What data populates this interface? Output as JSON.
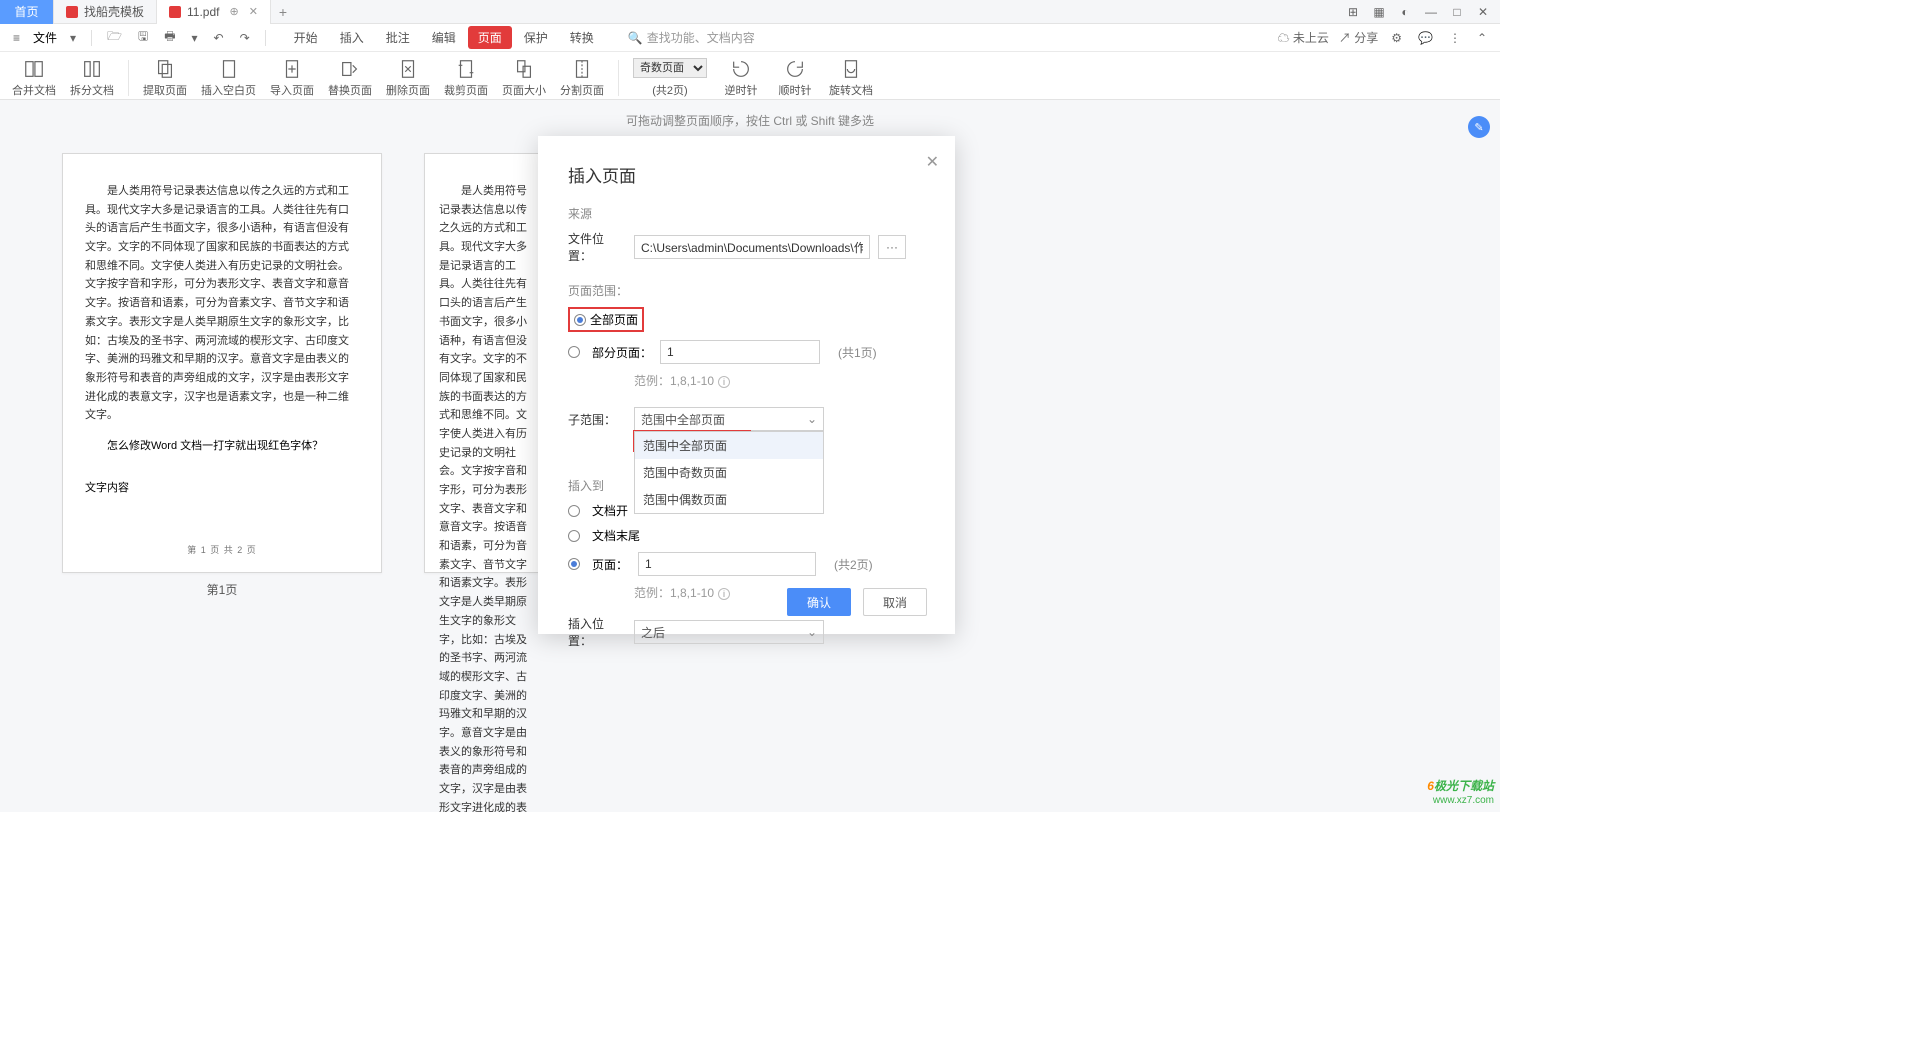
{
  "tabs": {
    "home": "首页",
    "t1": "找船壳模板",
    "t2": "11.pdf"
  },
  "window_icons": {
    "layout": "⊞",
    "grid": "▦",
    "user": "◐",
    "min": "—",
    "max": "□",
    "close": "✕"
  },
  "menu": {
    "file": "文件",
    "tabs": [
      "开始",
      "插入",
      "批注",
      "编辑",
      "页面",
      "保护",
      "转换"
    ],
    "active": "页面",
    "search_ph": "查找功能、文档内容"
  },
  "menu_right": {
    "cloud": "未上云",
    "share": "分享"
  },
  "ribbon": {
    "merge": "合并文档",
    "split": "拆分文档",
    "extract": "提取页面",
    "blank": "插入空白页",
    "import": "导入页面",
    "replace": "替换页面",
    "delete": "删除页面",
    "crop": "裁剪页面",
    "size": "页面大小",
    "splitpg": "分割页面",
    "pages_sel": "奇数页面",
    "pages_total": "(共2页)",
    "ccw": "逆时针",
    "cw": "顺时针",
    "rotate": "旋转文档"
  },
  "hint": "可拖动调整页面顺序，按住 Ctrl 或 Shift 键多选",
  "page": {
    "body": "是人类用符号记录表达信息以传之久远的方式和工具。现代文字大多是记录语言的工具。人类往往先有口头的语言后产生书面文字，很多小语种，有语言但没有文字。文字的不同体现了国家和民族的书面表达的方式和思维不同。文字使人类进入有历史记录的文明社会。文字按字音和字形，可分为表形文字、表音文字和意音文字。按语音和语素，可分为音素文字、音节文字和语素文字。表形文字是人类早期原生文字的象形文字，比如：古埃及的圣书字、两河流域的楔形文字、古印度文字、美洲的玛雅文和早期的汉字。意音文字是由表义的象形符号和表音的声旁组成的文字，汉字是由表形文字进化成的表意文字，汉字也是语素文字，也是一种二维文字。",
    "q": "怎么修改Word 文档一打字就出现红色字体？",
    "h": "文字内容",
    "footer": "第 1 页 共 2 页",
    "label": "第1页"
  },
  "dialog": {
    "title": "插入页面",
    "close": "✕",
    "src_label": "来源",
    "file_label": "文件位置：",
    "file_path": "C:\\Users\\admin\\Documents\\Downloads\\作文.docx",
    "browse": "···",
    "range_label": "页面范围：",
    "all": "全部页面",
    "partial": "部分页面：",
    "partial_val": "1",
    "partial_total": "(共1页)",
    "example": "范例：1,8,1-10",
    "sub_label": "子范围：",
    "sub_sel": "范围中全部页面",
    "opts": [
      "范围中全部页面",
      "范围中奇数页面",
      "范围中偶数页面"
    ],
    "ins_label": "插入到",
    "doc_start": "文档开",
    "doc_end": "文档末尾",
    "page_label": "页面：",
    "page_val": "1",
    "page_total": "(共2页)",
    "pos_label": "插入位置：",
    "pos_val": "之后",
    "ok": "确认",
    "cancel": "取消"
  },
  "watermark": {
    "brand": "极光下载站",
    "url": "www.xz7.com"
  },
  "chart_data": null
}
